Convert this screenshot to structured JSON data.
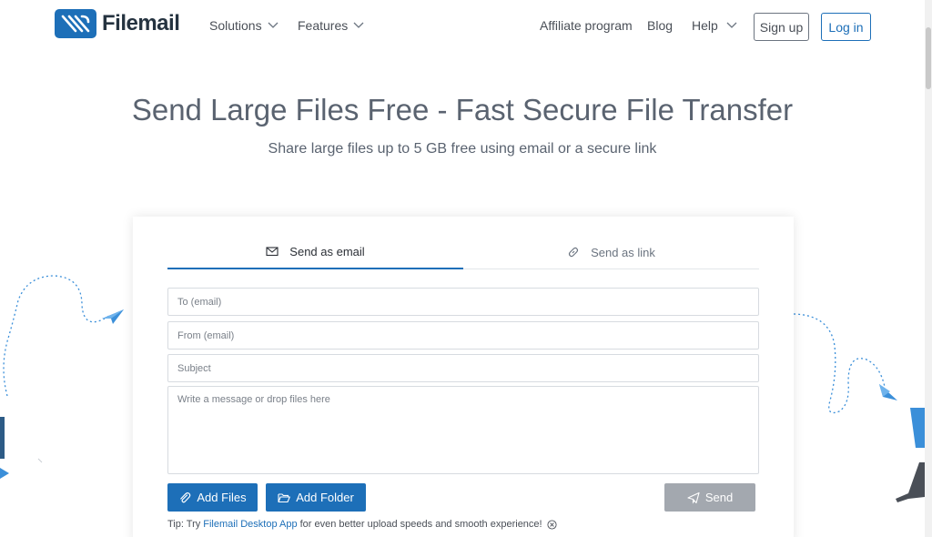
{
  "header": {
    "logo_text": "Filemail",
    "nav": [
      {
        "label": "Solutions",
        "has_dropdown": true
      },
      {
        "label": "Features",
        "has_dropdown": true
      }
    ],
    "right_nav": [
      {
        "label": "Affiliate program"
      },
      {
        "label": "Blog"
      },
      {
        "label": "Help",
        "has_dropdown": true
      }
    ],
    "signup_label": "Sign up",
    "login_label": "Log in"
  },
  "hero": {
    "title": "Send Large Files Free - Fast Secure File Transfer",
    "subtitle": "Share large files up to 5 GB free using email or a secure link"
  },
  "form": {
    "tabs": [
      {
        "label": "Send as email",
        "icon": "envelope-icon",
        "active": true
      },
      {
        "label": "Send as link",
        "icon": "link-icon",
        "active": false
      }
    ],
    "to_placeholder": "To (email)",
    "from_placeholder": "From (email)",
    "subject_placeholder": "Subject",
    "message_placeholder": "Write a message or drop files here",
    "add_files_label": "Add Files",
    "add_folder_label": "Add Folder",
    "send_label": "Send",
    "tip_prefix": "Tip: Try",
    "tip_link": "Filemail Desktop App",
    "tip_suffix": "for even better upload speeds and smooth experience!"
  },
  "colors": {
    "brand_blue": "#1d6fb8",
    "text": "#4a4f57",
    "disabled": "#a3a8af"
  }
}
